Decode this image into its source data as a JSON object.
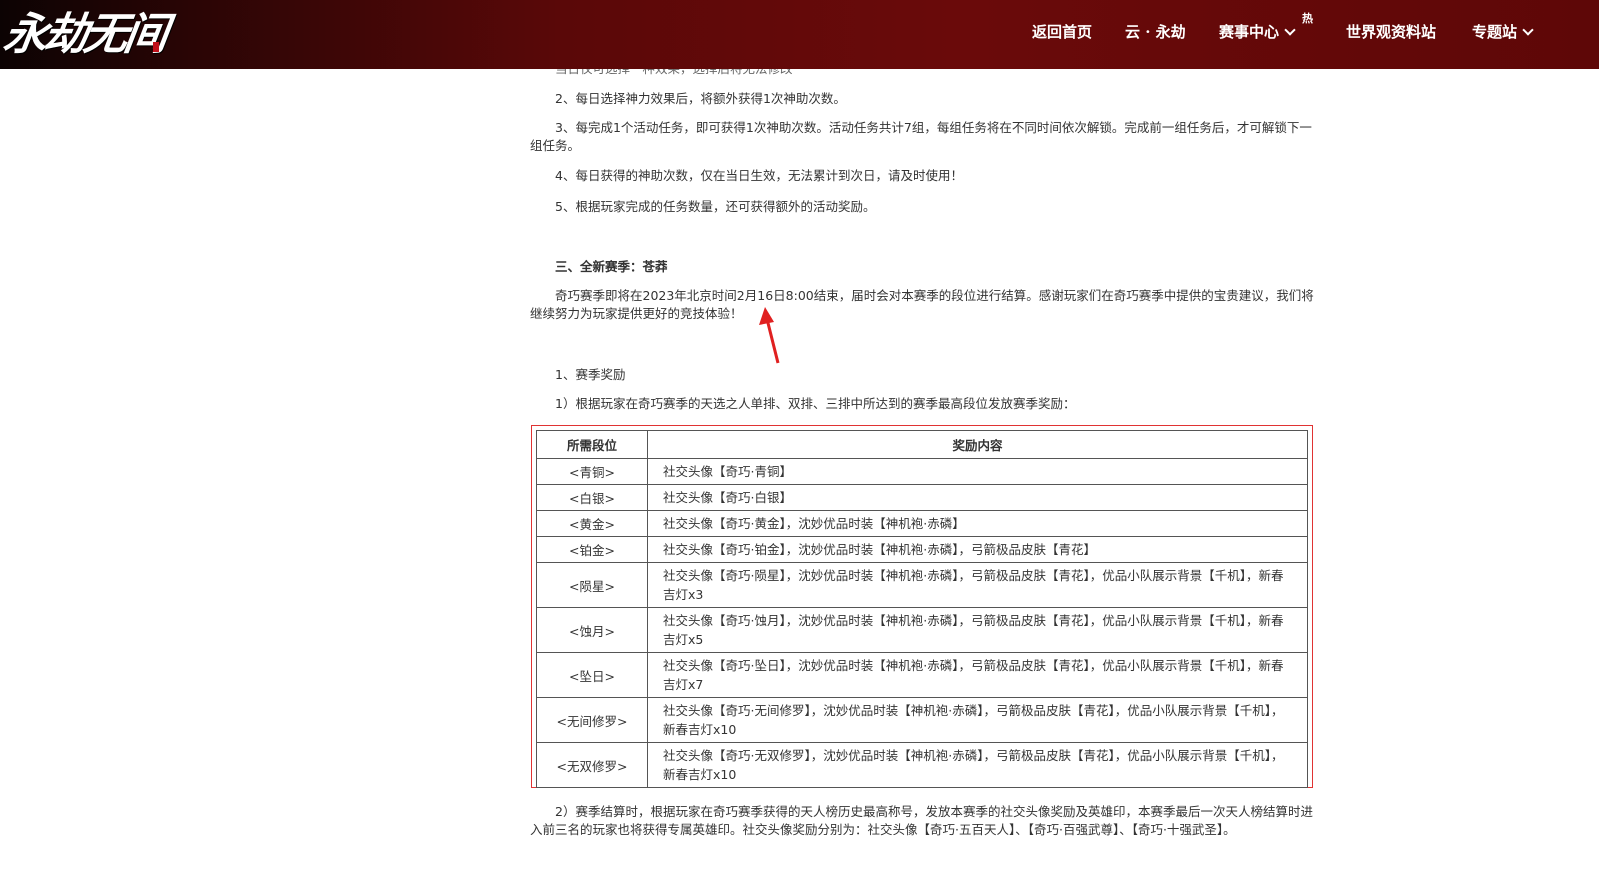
{
  "header": {
    "logo_text": "永劫无间",
    "nav": [
      {
        "label": "返回首页"
      },
      {
        "label": "云 · 永劫"
      },
      {
        "label": "赛事中心"
      },
      {
        "label": "世界观资料站"
      },
      {
        "label": "专题站"
      }
    ],
    "hot_badge": "热"
  },
  "article": {
    "cut_line": "当日仅可选择一种效果，选择后将无法修改",
    "rules": [
      "2、每日选择神力效果后，将额外获得1次神助次数。",
      "3、每完成1个活动任务，即可获得1次神助次数。活动任务共计7组，每组任务将在不同时间依次解锁。完成前一组任务后，才可解锁下一组任务。",
      "4、每日获得的神助次数，仅在当日生效，无法累计到次日，请及时使用！",
      "5、根据玩家完成的任务数量，还可获得额外的活动奖励。"
    ],
    "section_title": "三、全新赛季：苍莽",
    "section_intro": "奇巧赛季即将在2023年北京时间2月16日8:00结束，届时会对本赛季的段位进行结算。感谢玩家们在奇巧赛季中提供的宝贵建议，我们将继续努力为玩家提供更好的竞技体验！",
    "sub_title": "1、赛季奖励",
    "sub_point": "1）根据玩家在奇巧赛季的天选之人单排、双排、三排中所达到的赛季最高段位发放赛季奖励：",
    "closing": "2）赛季结算时，根据玩家在奇巧赛季获得的天人榜历史最高称号，发放本赛季的社交头像奖励及英雄印，本赛季最后一次天人榜结算时进入前三名的玩家也将获得专属英雄印。社交头像奖励分别为：社交头像【奇巧·五百天人】、【奇巧·百强武尊】、【奇巧·十强武圣】。"
  },
  "table": {
    "headers": [
      "所需段位",
      "奖励内容"
    ],
    "rows": [
      {
        "tier": "<青铜>",
        "reward": "社交头像【奇巧·青铜】"
      },
      {
        "tier": "<白银>",
        "reward": "社交头像【奇巧·白银】"
      },
      {
        "tier": "<黄金>",
        "reward": "社交头像【奇巧·黄金】，沈妙优品时装【神机袍·赤磷】"
      },
      {
        "tier": "<铂金>",
        "reward": "社交头像【奇巧·铂金】，沈妙优品时装【神机袍·赤磷】，弓箭极品皮肤【青花】"
      },
      {
        "tier": "<陨星>",
        "reward": "社交头像【奇巧·陨星】，沈妙优品时装【神机袍·赤磷】，弓箭极品皮肤【青花】，优品小队展示背景【千机】，新春吉灯x3"
      },
      {
        "tier": "<蚀月>",
        "reward": "社交头像【奇巧·蚀月】，沈妙优品时装【神机袍·赤磷】，弓箭极品皮肤【青花】，优品小队展示背景【千机】，新春吉灯x5"
      },
      {
        "tier": "<坠日>",
        "reward": "社交头像【奇巧·坠日】，沈妙优品时装【神机袍·赤磷】，弓箭极品皮肤【青花】，优品小队展示背景【千机】，新春吉灯x7"
      },
      {
        "tier": "<无间修罗>",
        "reward": "社交头像【奇巧·无间修罗】，沈妙优品时装【神机袍·赤磷】，弓箭极品皮肤【青花】，优品小队展示背景【千机】，新春吉灯x10"
      },
      {
        "tier": "<无双修罗>",
        "reward": "社交头像【奇巧·无双修罗】，沈妙优品时装【神机袍·赤磷】，弓箭极品皮肤【青花】，优品小队展示背景【千机】，新春吉灯x10"
      }
    ]
  },
  "colors": {
    "header_bg": "#6a0a0a",
    "table_highlight_border": "#e03333",
    "arrow": "#e02020"
  }
}
